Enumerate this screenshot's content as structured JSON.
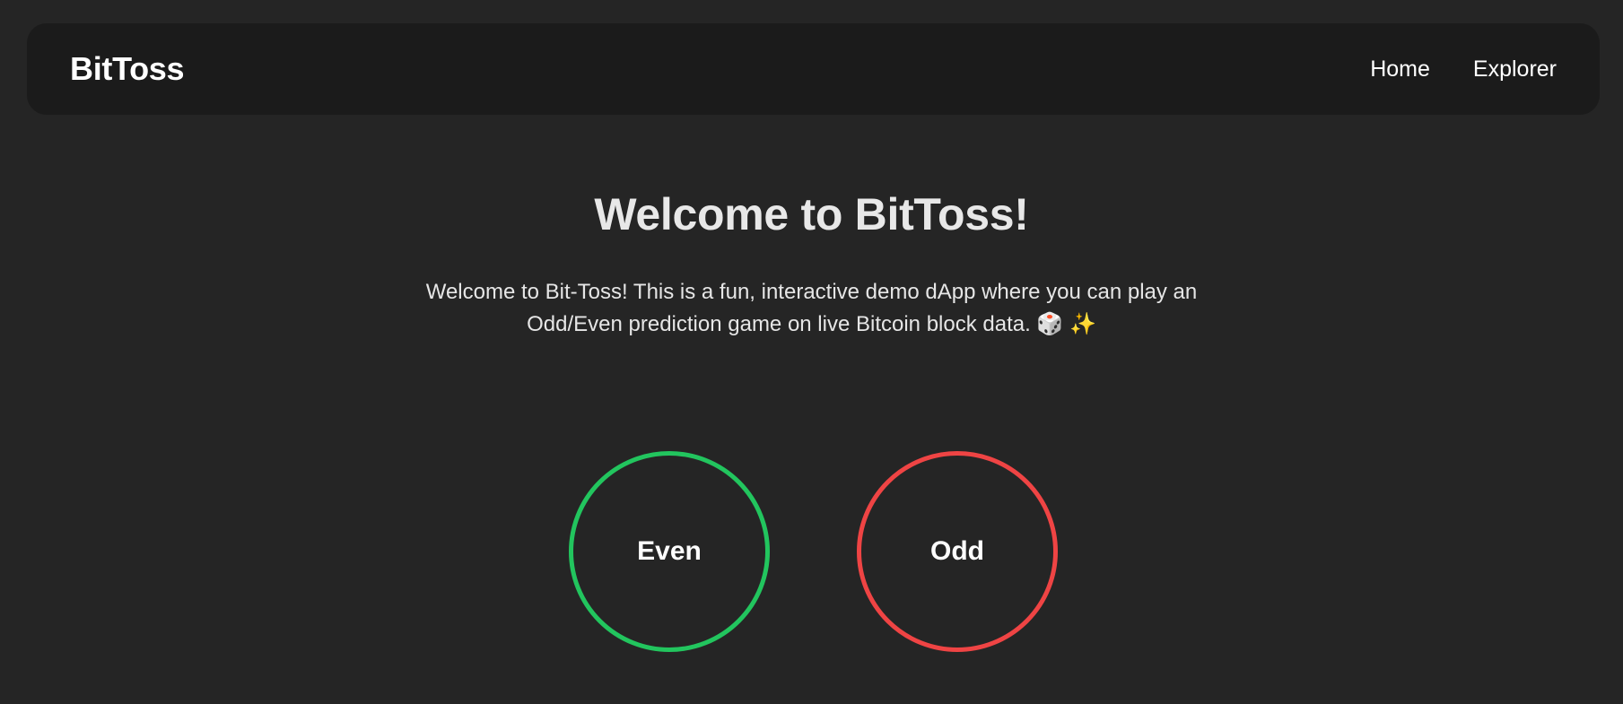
{
  "navbar": {
    "brand": "BitToss",
    "links": [
      {
        "label": "Home"
      },
      {
        "label": "Explorer"
      }
    ]
  },
  "hero": {
    "title": "Welcome to BitToss!",
    "description": "Welcome to Bit-Toss! This is a fun, interactive demo dApp where you can play an Odd/Even prediction game on live Bitcoin block data. 🎲 ✨"
  },
  "choices": {
    "even": {
      "label": "Even",
      "color": "#22c55e"
    },
    "odd": {
      "label": "Odd",
      "color": "#ef4444"
    }
  },
  "colors": {
    "background": "#252525",
    "navbar": "#1b1b1b",
    "text": "#e6e6e6"
  }
}
